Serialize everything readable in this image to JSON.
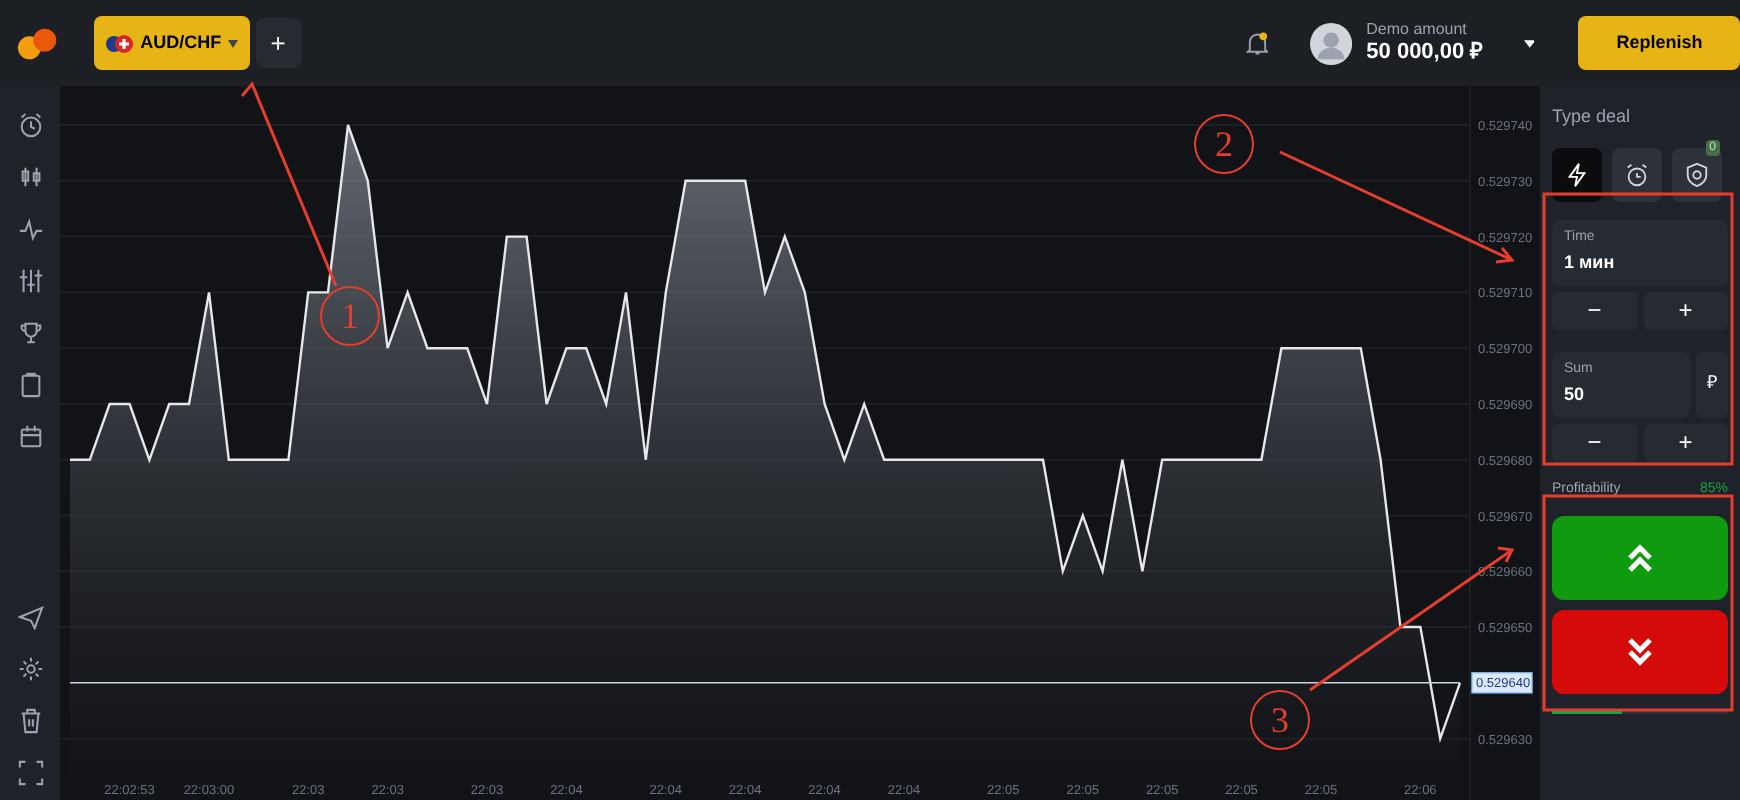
{
  "top_bar": {
    "asset_tab": {
      "label": "AUD/CHF",
      "selected": true
    },
    "add_tab": "+",
    "balance": {
      "caption": "Demo amount",
      "amount": "50 000,00 ₽"
    },
    "replenish_button": "Replenish"
  },
  "chart": {
    "chart_data": {
      "type": "area",
      "grid": true,
      "categories": [
        null,
        null,
        null,
        "22:02:53",
        null,
        null,
        null,
        "22:03:00",
        null,
        null,
        null,
        null,
        "22:03",
        null,
        null,
        null,
        "22:03",
        null,
        null,
        null,
        null,
        "22:03",
        null,
        null,
        null,
        "22:04",
        null,
        null,
        null,
        null,
        "22:04",
        null,
        null,
        null,
        "22:04",
        null,
        null,
        null,
        "22:04",
        null,
        null,
        null,
        "22:04",
        null,
        null,
        null,
        null,
        "22:05",
        null,
        null,
        null,
        "22:05",
        null,
        null,
        null,
        "22:05",
        null,
        null,
        null,
        "22:05",
        null,
        null,
        null,
        "22:05",
        null,
        null,
        null,
        null,
        "22:06",
        null,
        null
      ],
      "series": [
        {
          "color": "#e5e7eb",
          "values": [
            0.52968,
            0.52968,
            0.52969,
            0.52969,
            0.52968,
            0.52969,
            0.52969,
            0.52971,
            0.52968,
            0.52968,
            0.52968,
            0.52968,
            0.52971,
            0.52971,
            0.52974,
            0.52973,
            0.5297,
            0.52971,
            0.5297,
            0.5297,
            0.5297,
            0.52969,
            0.52972,
            0.52972,
            0.52969,
            0.5297,
            0.5297,
            0.52969,
            0.52971,
            0.52968,
            0.52971,
            0.52973,
            0.52973,
            0.52973,
            0.52973,
            0.52971,
            0.52972,
            0.52971,
            0.52969,
            0.52968,
            0.52969,
            0.52968,
            0.52968,
            0.52968,
            0.52968,
            0.52968,
            0.52968,
            0.52968,
            0.52968,
            0.52968,
            0.52966,
            0.52967,
            0.52966,
            0.52968,
            0.52966,
            0.52968,
            0.52968,
            0.52968,
            0.52968,
            0.52968,
            0.52968,
            0.5297,
            0.5297,
            0.5297,
            0.5297,
            0.5297,
            0.52968,
            0.52965,
            0.52965,
            0.52963,
            0.52964
          ]
        },
        {
          "type": "line",
          "color": "#cbd5e1",
          "values": [
            0.52964,
            0.52964,
            0.52964,
            0.52964,
            0.52964,
            0.52964,
            0.52964,
            0.52964,
            0.52964,
            0.52964,
            0.52964,
            0.52964,
            0.52964,
            0.52964,
            0.52964,
            0.52964,
            0.52964,
            0.52964,
            0.52964,
            0.52964,
            0.52964,
            0.52964,
            0.52964,
            0.52964,
            0.52964,
            0.52964,
            0.52964,
            0.52964,
            0.52964,
            0.52964,
            0.52964,
            0.52964,
            0.52964,
            0.52964,
            0.52964,
            0.52964,
            0.52964,
            0.52964,
            0.52964,
            0.52964,
            0.52964,
            0.52964,
            0.52964,
            0.52964,
            0.52964,
            0.52964,
            0.52964,
            0.52964,
            0.52964,
            0.52964,
            0.52964,
            0.52964,
            0.52964,
            0.52964,
            0.52964,
            0.52964,
            0.52964,
            0.52964,
            0.52964,
            0.52964,
            0.52964,
            0.52964,
            0.52964,
            0.52964,
            0.52964,
            0.52964,
            0.52964,
            0.52964,
            0.52964,
            0.52964,
            0.52964
          ]
        }
      ],
      "ylim": [
        0.529619,
        0.529747
      ],
      "yticks": [
        {
          "value": 0.52974,
          "label": "0.529740"
        },
        {
          "value": 0.52973,
          "label": "0.529730"
        },
        {
          "value": 0.52972,
          "label": "0.529720"
        },
        {
          "value": 0.52971,
          "label": "0.529710"
        },
        {
          "value": 0.5297,
          "label": "0.529700"
        },
        {
          "value": 0.52969,
          "label": "0.529690"
        },
        {
          "value": 0.52968,
          "label": "0.529680"
        },
        {
          "value": 0.52967,
          "label": "0.529670"
        },
        {
          "value": 0.52966,
          "label": "0.529660"
        },
        {
          "value": 0.52965,
          "label": "0.529650"
        },
        {
          "value": 0.52963,
          "label": "0.529630"
        }
      ]
    },
    "current_price_label": "0.529640"
  },
  "deal_panel": {
    "title": "Type deal",
    "deal_types": [
      {
        "kind": "bolt",
        "selected": true
      },
      {
        "kind": "alarm",
        "selected": false
      },
      {
        "kind": "shield",
        "selected": false,
        "badge": "0"
      }
    ],
    "time": {
      "label": "Time",
      "value": "1 мин",
      "minus": "−",
      "plus": "+"
    },
    "sum": {
      "label": "Sum",
      "value": "50",
      "currency": "₽",
      "minus": "−",
      "plus": "+"
    },
    "profitability": {
      "label": "Profitability",
      "value": "85%"
    },
    "progress": {
      "level": 0.4
    }
  },
  "annotations": [
    {
      "label": "1"
    },
    {
      "label": "2"
    },
    {
      "label": "3"
    }
  ]
}
